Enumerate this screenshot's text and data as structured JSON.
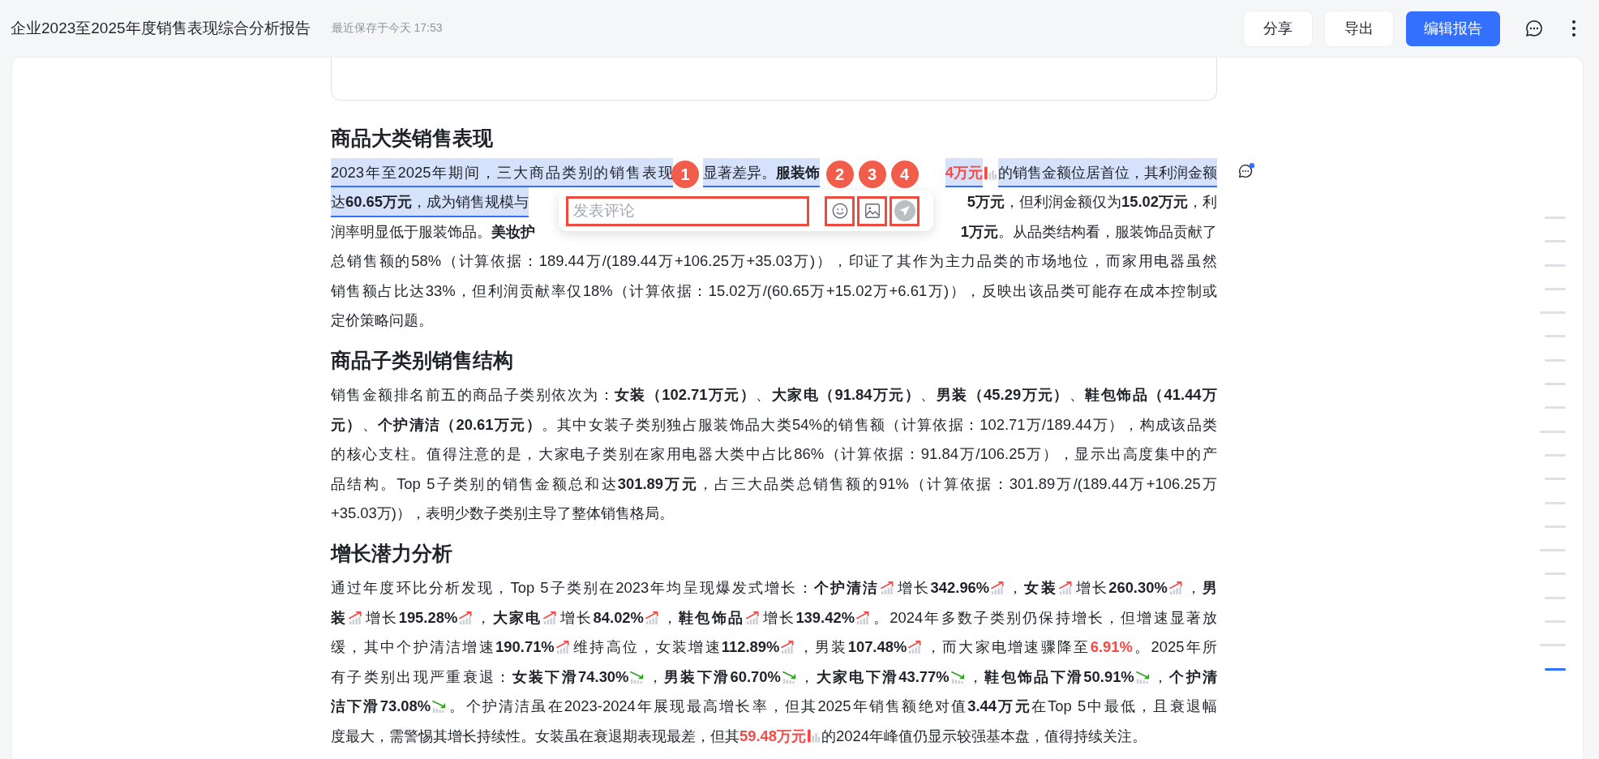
{
  "top_bar": {
    "title": "企业2023至2025年度销售表现综合分析报告",
    "saved": "最近保存于今天 17:53",
    "buttons": [
      {
        "label": "分享",
        "kind": "default"
      },
      {
        "label": "导出",
        "kind": "default"
      },
      {
        "label": "编辑报告",
        "kind": "primary"
      }
    ]
  },
  "sections": [
    {
      "heading": "商品大类销售表现",
      "comment_marker": {
        "unread": true
      },
      "covered_lines": [
        {
          "left": [
            {
              "kind": "text",
              "text": "2023年至2025年期间，三大商品类别的销售表现",
              "highlighted": true
            },
            {
              "kind": "text",
              "text": "显著差异。**服装饰**",
              "highlighted": true
            }
          ],
          "right": [
            {
              "kind": "red",
              "text": "4万元",
              "highlighted": true
            },
            {
              "kind": "bar"
            },
            {
              "kind": "text",
              "text": "的销售金额位居首位，其利润金额",
              "highlighted": true
            }
          ]
        },
        {
          "left": [
            {
              "kind": "text",
              "text": "达**60.65万元**，成为销售规模与",
              "highlighted": true
            }
          ],
          "right": [
            {
              "kind": "text",
              "text": "**5万元**，但利润金额仅为**15.02万元**，利",
              "highlighted": false
            }
          ]
        },
        {
          "left": [
            {
              "kind": "text",
              "text": "润率明显低于服装饰品。**美妆护**",
              "highlighted": false
            }
          ],
          "right": [
            {
              "kind": "text",
              "text": "**1万元**。从品类结构看，服装饰品贡献了",
              "highlighted": false
            }
          ]
        }
      ],
      "lines": [
        [
          {
            "kind": "text",
            "text": "总销售额的58%（计算依据：189.44万/(189.44万+106.25万+35.03万)），印证了其作为主力品类的市场地位，而家用电器虽然"
          }
        ],
        [
          {
            "kind": "text",
            "text": "销售额占比达33%，但利润贡献率仅18%（计算依据：15.02万/(60.65万+15.02万+6.61万)），反映出该品类可能存在成本控制或"
          }
        ],
        [
          {
            "kind": "text",
            "text": "定价策略问题。"
          }
        ]
      ]
    },
    {
      "heading": "商品子类别销售结构",
      "lines": [
        [
          {
            "kind": "text",
            "text": "销售金额排名前五的商品子类别依次为：**女装（102.71万元）**、**大家电（91.84万元）**、**男装（45.29万元）**、**鞋包饰品（41.44万**"
          }
        ],
        [
          {
            "kind": "text",
            "text": "**元）**、**个护清洁（20.61万元）**。其中女装子类别独占服装饰品大类54%的销售额（计算依据：102.71万/189.44万），构成该品类"
          }
        ],
        [
          {
            "kind": "text",
            "text": "的核心支柱。值得注意的是，大家电子类别在家用电器大类中占比86%（计算依据：91.84万/106.25万），显示出高度集中的产"
          }
        ],
        [
          {
            "kind": "text",
            "text": "品结构。Top 5子类别的销售金额总和达**301.89万元**，占三大品类总销售额的91%（计算依据：301.89万/(189.44万+106.25万"
          }
        ],
        [
          {
            "kind": "text",
            "text": "+35.03万)），表明少数子类别主导了整体销售格局。"
          }
        ]
      ]
    },
    {
      "heading": "增长潜力分析",
      "lines": [
        [
          {
            "kind": "text",
            "text": "通过年度环比分析发现，Top 5子类别在2023年均呈现爆发式增长：**个护清洁**"
          },
          {
            "kind": "up"
          },
          {
            "kind": "text",
            "text": "增长**342.96%**"
          },
          {
            "kind": "up"
          },
          {
            "kind": "text",
            "text": "，**女装**"
          },
          {
            "kind": "up"
          },
          {
            "kind": "text",
            "text": "增长**260.30%**"
          },
          {
            "kind": "up"
          },
          {
            "kind": "text",
            "text": "，**男**"
          }
        ],
        [
          {
            "kind": "text",
            "text": "**装**"
          },
          {
            "kind": "up"
          },
          {
            "kind": "text",
            "text": "增长**195.28%**"
          },
          {
            "kind": "up"
          },
          {
            "kind": "text",
            "text": "，**大家电**"
          },
          {
            "kind": "up"
          },
          {
            "kind": "text",
            "text": "增长**84.02%**"
          },
          {
            "kind": "up"
          },
          {
            "kind": "text",
            "text": "，**鞋包饰品**"
          },
          {
            "kind": "up"
          },
          {
            "kind": "text",
            "text": "增长**139.42%**"
          },
          {
            "kind": "up"
          },
          {
            "kind": "text",
            "text": "。2024年多数子类别仍保持增长，但增速显著放"
          }
        ],
        [
          {
            "kind": "text",
            "text": "缓，其中个护清洁增速**190.71%**"
          },
          {
            "kind": "up"
          },
          {
            "kind": "text",
            "text": "维持高位，女装增速**112.89%**"
          },
          {
            "kind": "up"
          },
          {
            "kind": "text",
            "text": "，男装**107.48%**"
          },
          {
            "kind": "up"
          },
          {
            "kind": "text",
            "text": "，而大家电增速骤降至"
          },
          {
            "kind": "red",
            "text": "6.91%"
          },
          {
            "kind": "text",
            "text": "。2025年所"
          }
        ],
        [
          {
            "kind": "text",
            "text": "有子类别出现严重衰退：**女装下滑74.30%**"
          },
          {
            "kind": "down"
          },
          {
            "kind": "text",
            "text": "，**男装下滑60.70%**"
          },
          {
            "kind": "down"
          },
          {
            "kind": "text",
            "text": "，**大家电下滑43.77%**"
          },
          {
            "kind": "down"
          },
          {
            "kind": "text",
            "text": "，**鞋包饰品下滑50.91%**"
          },
          {
            "kind": "down"
          },
          {
            "kind": "text",
            "text": "，**个护清**"
          }
        ],
        [
          {
            "kind": "text",
            "text": "**洁下滑73.08%**"
          },
          {
            "kind": "down"
          },
          {
            "kind": "text",
            "text": "。个护清洁虽在2023-2024年展现最高增长率，但其2025年销售额绝对值**3.44万元**在Top 5中最低，且衰退幅"
          }
        ],
        [
          {
            "kind": "text",
            "text": "度最大，需警惕其增长持续性。女装虽在衰退期表现最差，但其"
          },
          {
            "kind": "red",
            "text": "59.48万元"
          },
          {
            "kind": "bar"
          },
          {
            "kind": "text",
            "text": "的2024年峰值仍显示较强基本盘，值得持续关注。"
          }
        ]
      ]
    }
  ],
  "comment_popup": {
    "input": {
      "placeholder": "发表评论",
      "callout": "1"
    },
    "buttons": [
      {
        "kind": "emoji",
        "callout": "2"
      },
      {
        "kind": "image",
        "callout": "3"
      },
      {
        "kind": "send",
        "callout": "4"
      }
    ]
  },
  "outline": [
    {
      "kind": "minor",
      "selected": false
    },
    {
      "kind": "minor",
      "selected": false
    },
    {
      "kind": "minor",
      "selected": false
    },
    {
      "kind": "minor",
      "selected": false
    },
    {
      "kind": "major",
      "selected": false
    },
    {
      "kind": "minor",
      "selected": false
    },
    {
      "kind": "minor",
      "selected": false
    },
    {
      "kind": "minor",
      "selected": false
    },
    {
      "kind": "minor",
      "selected": false
    },
    {
      "kind": "major",
      "selected": false
    },
    {
      "kind": "minor",
      "selected": false
    },
    {
      "kind": "minor",
      "selected": false
    },
    {
      "kind": "minor",
      "selected": false
    },
    {
      "kind": "minor",
      "selected": false
    },
    {
      "kind": "major",
      "selected": false
    },
    {
      "kind": "minor",
      "selected": false
    },
    {
      "kind": "minor",
      "selected": false
    },
    {
      "kind": "minor",
      "selected": false
    },
    {
      "kind": "major",
      "selected": false
    },
    {
      "kind": "minor",
      "selected": true
    }
  ]
}
